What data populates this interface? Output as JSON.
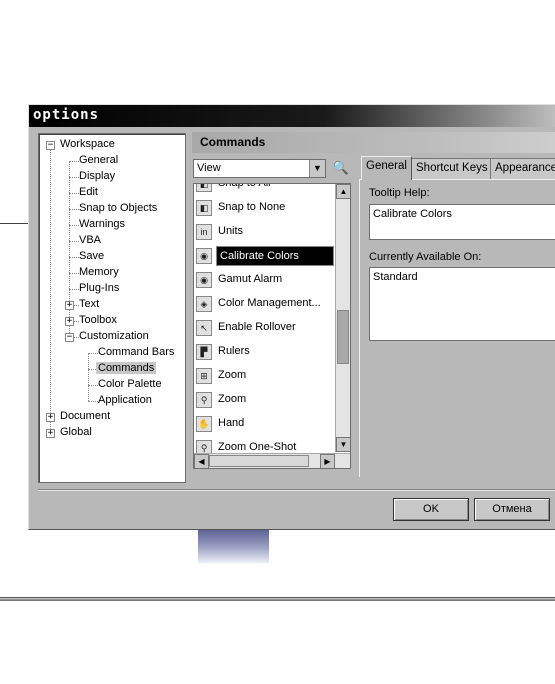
{
  "dialog": {
    "title": "options"
  },
  "tree": {
    "items": [
      {
        "label": "Workspace",
        "expander": "−"
      },
      {
        "label": "General"
      },
      {
        "label": "Display"
      },
      {
        "label": "Edit"
      },
      {
        "label": "Snap to Objects"
      },
      {
        "label": "Warnings"
      },
      {
        "label": "VBA"
      },
      {
        "label": "Save"
      },
      {
        "label": "Memory"
      },
      {
        "label": "Plug-Ins"
      },
      {
        "label": "Text",
        "expander": "+"
      },
      {
        "label": "Toolbox",
        "expander": "+"
      },
      {
        "label": "Customization",
        "expander": "−"
      },
      {
        "label": "Command Bars"
      },
      {
        "label": "Commands",
        "selected": true
      },
      {
        "label": "Color Palette"
      },
      {
        "label": "Application"
      },
      {
        "label": "Document",
        "expander": "+"
      },
      {
        "label": "Global",
        "expander": "+"
      }
    ]
  },
  "commands": {
    "header": "Commands",
    "category_value": "View",
    "items": [
      {
        "label": "Snap to All",
        "icon": "snap-all-icon",
        "glyph": "◧"
      },
      {
        "label": "Snap to None",
        "icon": "snap-none-icon",
        "glyph": "◧"
      },
      {
        "label": "Units",
        "icon": "units-icon",
        "glyph": "in"
      },
      {
        "label": "Calibrate Colors",
        "icon": "color-wheel-icon",
        "glyph": "◉",
        "selected": true
      },
      {
        "label": "Gamut Alarm",
        "icon": "gamut-alarm-icon",
        "glyph": "◉"
      },
      {
        "label": "Color Management...",
        "icon": "color-management-icon",
        "glyph": "◈"
      },
      {
        "label": "Enable Rollover",
        "icon": "rollover-icon",
        "glyph": "↖"
      },
      {
        "label": "Rulers",
        "icon": "rulers-icon",
        "glyph": "▛"
      },
      {
        "label": "Zoom",
        "icon": "zoom-toolbar-icon",
        "glyph": "⊞"
      },
      {
        "label": "Zoom",
        "icon": "zoom-icon",
        "glyph": "⚲"
      },
      {
        "label": "Hand",
        "icon": "hand-icon",
        "glyph": "✋"
      },
      {
        "label": "Zoom One-Shot",
        "icon": "zoom-oneshot-icon",
        "glyph": "⚲"
      }
    ]
  },
  "tabs": [
    {
      "label": "General",
      "active": true
    },
    {
      "label": "Shortcut Keys"
    },
    {
      "label": "Appearance"
    }
  ],
  "general": {
    "tooltip_label": "Tooltip Help:",
    "tooltip_value": "Calibrate Colors",
    "available_label": "Currently Available On:",
    "available_value": "Standard"
  },
  "buttons": {
    "ok": "OK",
    "cancel": "Отмена"
  }
}
